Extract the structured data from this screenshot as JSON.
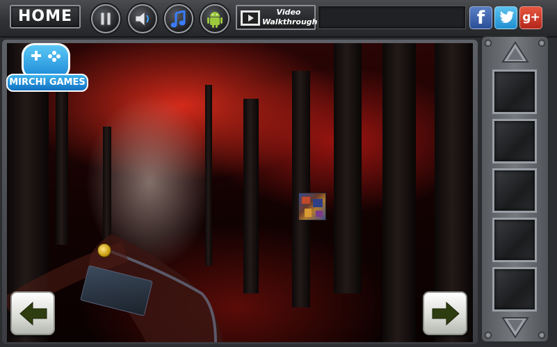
{
  "topbar": {
    "home_label": "HOME",
    "pause_icon": "pause-icon",
    "sound_icon": "speaker-icon",
    "music_icon": "music-note-icon",
    "android_icon": "android-icon",
    "video_line1": "Video",
    "video_line2": "Walkthrough",
    "social": {
      "facebook": "f",
      "twitter_icon": "twitter-bird-icon",
      "googleplus": "g+"
    }
  },
  "logo": {
    "text": "MIRCHI GAMES",
    "icon": "gamepad-icon"
  },
  "scene": {
    "description_icons": [
      "puzzle-tile-item",
      "gold-coin-item"
    ]
  },
  "navigation": {
    "left_icon": "arrow-left-icon",
    "right_icon": "arrow-right-icon"
  },
  "inventory": {
    "up_icon": "chevron-up-icon",
    "down_icon": "chevron-down-icon",
    "slots": [
      "",
      "",
      "",
      "",
      ""
    ]
  },
  "colors": {
    "foliage": "#c4160d",
    "button_face": "#e8eae4",
    "arrow": "#2e3d10",
    "facebook": "#3b5998",
    "twitter": "#2aa3e6",
    "googleplus": "#d0392b"
  }
}
